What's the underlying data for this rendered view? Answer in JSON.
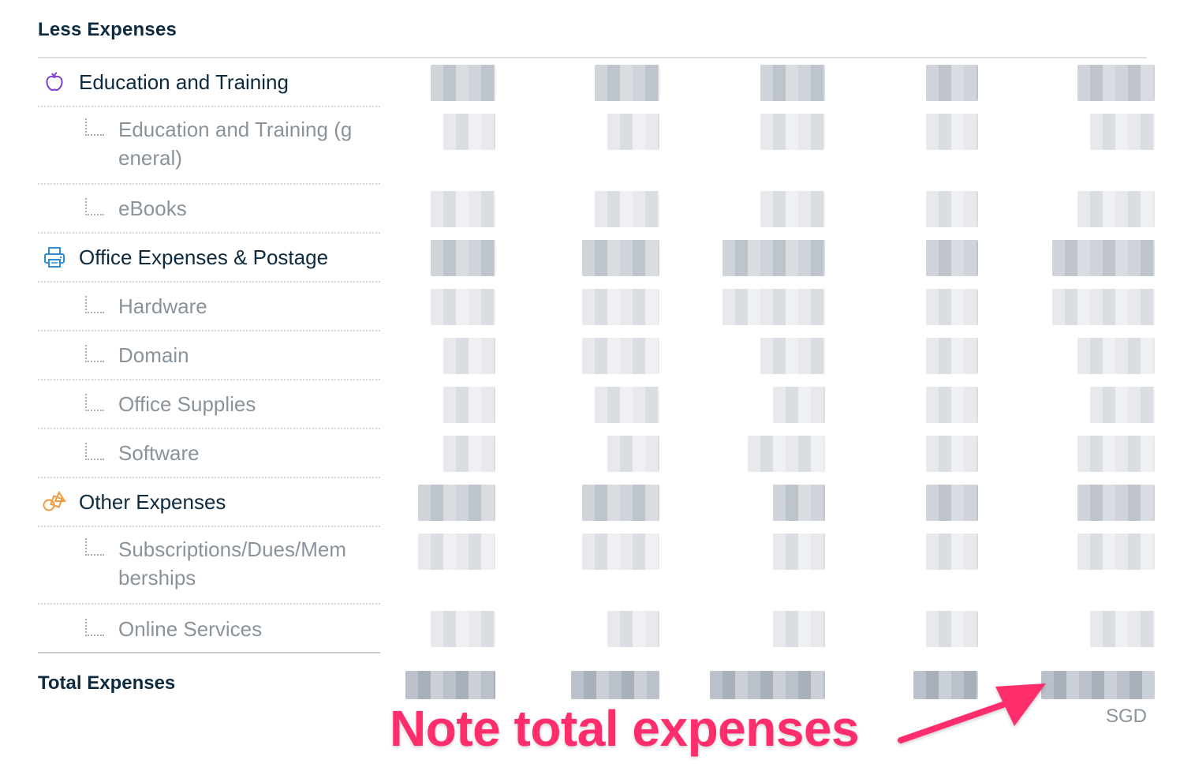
{
  "section": {
    "title": "Less Expenses"
  },
  "rows": [
    {
      "kind": "category",
      "label": "Education and Training",
      "icon": "apple-icon",
      "color": "#7b3fd1"
    },
    {
      "kind": "sub",
      "label": "Education and Training (general)"
    },
    {
      "kind": "sub",
      "label": "eBooks"
    },
    {
      "kind": "category",
      "label": "Office Expenses & Postage",
      "icon": "printer-icon",
      "color": "#2b8fd6"
    },
    {
      "kind": "sub",
      "label": "Hardware"
    },
    {
      "kind": "sub",
      "label": "Domain"
    },
    {
      "kind": "sub",
      "label": "Office Supplies"
    },
    {
      "kind": "sub",
      "label": "Software"
    },
    {
      "kind": "category",
      "label": "Other Expenses",
      "icon": "shapes-icon",
      "color": "#f29b3c"
    },
    {
      "kind": "sub",
      "label": "Subscriptions/Dues/Memberships"
    },
    {
      "kind": "sub",
      "label": "Online Services"
    }
  ],
  "total": {
    "label": "Total Expenses"
  },
  "currency": "SGD",
  "annotation": {
    "text": "Note total expenses",
    "color": "#fe2d6c"
  }
}
